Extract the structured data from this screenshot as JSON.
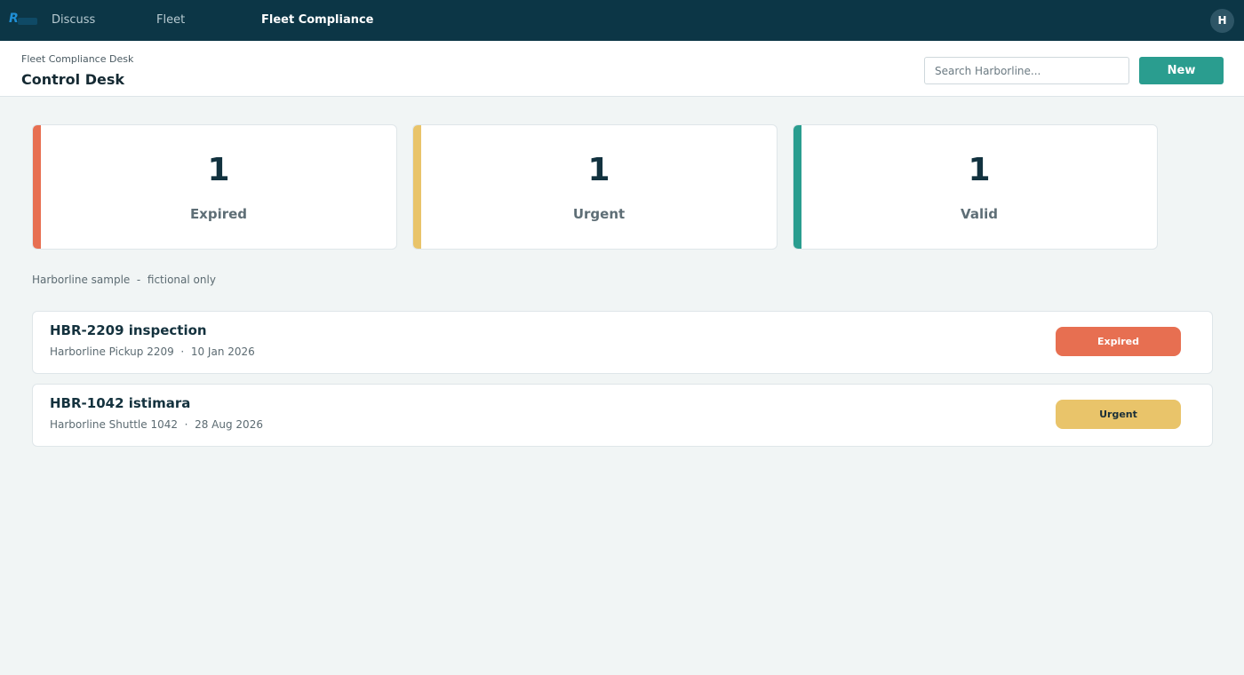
{
  "topnav": {
    "logo_icon": "harborline-logo-icon",
    "items": [
      {
        "label": "Discuss"
      },
      {
        "label": "Fleet"
      },
      {
        "label": "Fleet Compliance"
      }
    ],
    "avatar_initial": "H"
  },
  "header": {
    "breadcrumb": "Fleet Compliance Desk",
    "title": "Control Desk",
    "search_placeholder": "Search Harborline...",
    "new_label": "New"
  },
  "colors": {
    "nav_bg": "#0c3646",
    "expired": "#e76f51",
    "urgent": "#e9c46a",
    "valid": "#2a9d8f"
  },
  "kpis": [
    {
      "value": "1",
      "label": "Expired"
    },
    {
      "value": "1",
      "label": "Urgent"
    },
    {
      "value": "1",
      "label": "Valid"
    }
  ],
  "note": "Harborline sample  -  fictional only",
  "records": [
    {
      "title": "HBR-2209 inspection",
      "vehicle": "Harborline Pickup 2209",
      "separator": "·",
      "date": "10 Jan 2026",
      "status": "Expired"
    },
    {
      "title": "HBR-1042 istimara",
      "vehicle": "Harborline Shuttle 1042",
      "separator": "·",
      "date": "28 Aug 2026",
      "status": "Urgent"
    }
  ]
}
